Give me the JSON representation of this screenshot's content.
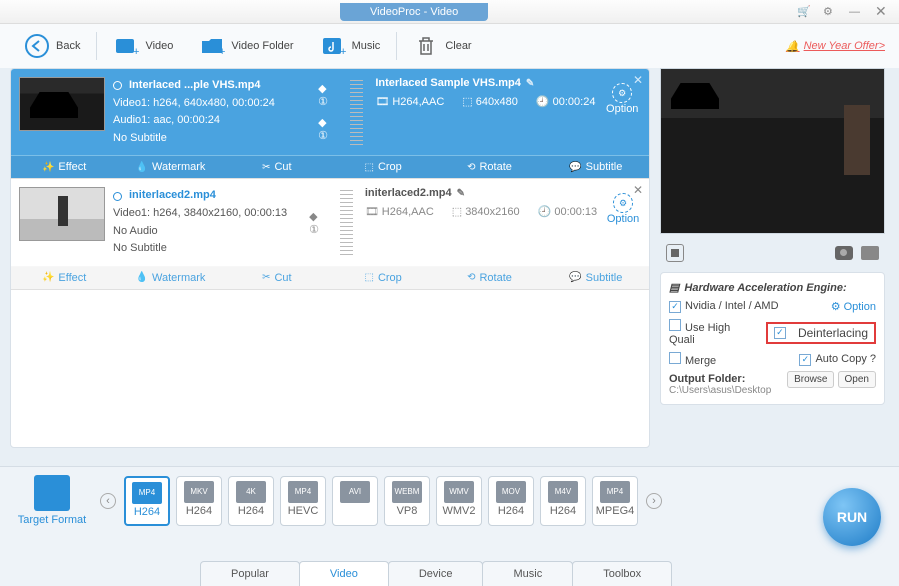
{
  "titlebar": {
    "title": "VideoProc - Video"
  },
  "toolbar": {
    "back": "Back",
    "video": "Video",
    "folder": "Video Folder",
    "music": "Music",
    "clear": "Clear",
    "offer": "New Year Offer>"
  },
  "cards": [
    {
      "filename": "Interlaced ...ple VHS.mp4",
      "video_line": "Video1: h264, 640x480, 00:00:24",
      "audio_line": "Audio1: aac, 00:00:24",
      "sub_line": "No Subtitle",
      "out_name": "Interlaced Sample VHS.mp4",
      "codec": "H264,AAC",
      "res": "640x480",
      "dur": "00:00:24",
      "option": "Option"
    },
    {
      "filename": "initerlaced2.mp4",
      "video_line": "Video1: h264, 3840x2160, 00:00:13",
      "audio_line": "No Audio",
      "sub_line": "No Subtitle",
      "out_name": "initerlaced2.mp4",
      "codec": "H264,AAC",
      "res": "3840x2160",
      "dur": "00:00:13",
      "option": "Option"
    }
  ],
  "tools": {
    "effect": "Effect",
    "watermark": "Watermark",
    "cut": "Cut",
    "crop": "Crop",
    "rotate": "Rotate",
    "subtitle": "Subtitle"
  },
  "side": {
    "hw_title": "Hardware Acceleration Engine:",
    "gpu": "Nvidia / Intel / AMD",
    "option": "Option",
    "usehq": "Use High Quali",
    "deint": "Deinterlacing",
    "merge": "Merge",
    "autocopy": "Auto Copy ?",
    "outfolder_lbl": "Output Folder:",
    "browse": "Browse",
    "open": "Open",
    "path": "C:\\Users\\asus\\Desktop"
  },
  "formats": [
    {
      "top": "MP4",
      "bot": "H264",
      "sel": true
    },
    {
      "top": "MKV",
      "bot": "H264"
    },
    {
      "top": "4K",
      "bot": "H264"
    },
    {
      "top": "MP4",
      "bot": "HEVC"
    },
    {
      "top": "AVI",
      "bot": ""
    },
    {
      "top": "WEBM",
      "bot": "VP8"
    },
    {
      "top": "WMV",
      "bot": "WMV2"
    },
    {
      "top": "MOV",
      "bot": "H264"
    },
    {
      "top": "M4V",
      "bot": "H264"
    },
    {
      "top": "MP4",
      "bot": "MPEG4"
    }
  ],
  "tgt_label": "Target Format",
  "run": "RUN",
  "tabs": {
    "popular": "Popular",
    "video": "Video",
    "device": "Device",
    "music": "Music",
    "toolbox": "Toolbox"
  }
}
